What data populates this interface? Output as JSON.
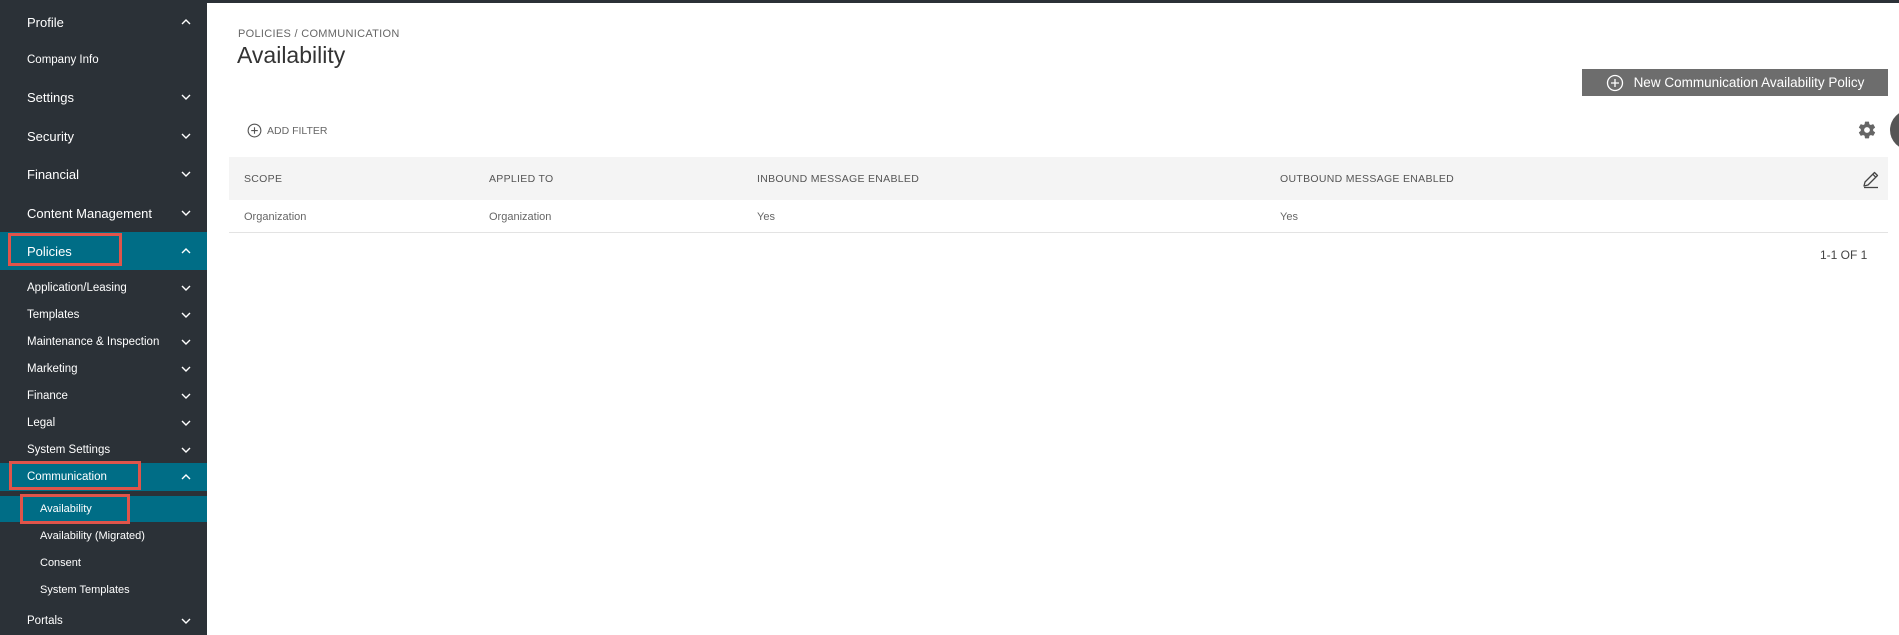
{
  "sidebar": {
    "items": [
      {
        "label": "Profile",
        "chevron": "up"
      },
      {
        "label": "Company Info",
        "chevron": ""
      },
      {
        "label": "Settings",
        "chevron": "down"
      },
      {
        "label": "Security",
        "chevron": "down"
      },
      {
        "label": "Financial",
        "chevron": "down"
      },
      {
        "label": "Content Management",
        "chevron": "down"
      },
      {
        "label": "Policies",
        "chevron": "up"
      },
      {
        "label": "Application/Leasing",
        "chevron": "down"
      },
      {
        "label": "Templates",
        "chevron": "down"
      },
      {
        "label": "Maintenance & Inspection",
        "chevron": "down"
      },
      {
        "label": "Marketing",
        "chevron": "down"
      },
      {
        "label": "Finance",
        "chevron": "down"
      },
      {
        "label": "Legal",
        "chevron": "down"
      },
      {
        "label": "System Settings",
        "chevron": "down"
      },
      {
        "label": "Communication",
        "chevron": "up"
      },
      {
        "label": "Availability",
        "chevron": ""
      },
      {
        "label": "Availability (Migrated)",
        "chevron": ""
      },
      {
        "label": "Consent",
        "chevron": ""
      },
      {
        "label": "System Templates",
        "chevron": ""
      },
      {
        "label": "Portals",
        "chevron": "down"
      }
    ]
  },
  "header": {
    "breadcrumb": "POLICIES / COMMUNICATION",
    "title": "Availability"
  },
  "toolbar": {
    "new_button_label": "New Communication Availability Policy",
    "add_filter_label": "ADD FILTER"
  },
  "table": {
    "columns": [
      "SCOPE",
      "APPLIED TO",
      "INBOUND MESSAGE ENABLED",
      "OUTBOUND MESSAGE ENABLED"
    ],
    "rows": [
      [
        "Organization",
        "Organization",
        "Yes",
        "Yes"
      ]
    ]
  },
  "pagination": {
    "text": "1-1 OF 1"
  },
  "colors": {
    "sidebar_bg": "#2b3137",
    "active_bg": "#006d86",
    "highlight": "#e0544a",
    "button_bg": "#6d6d6d"
  }
}
